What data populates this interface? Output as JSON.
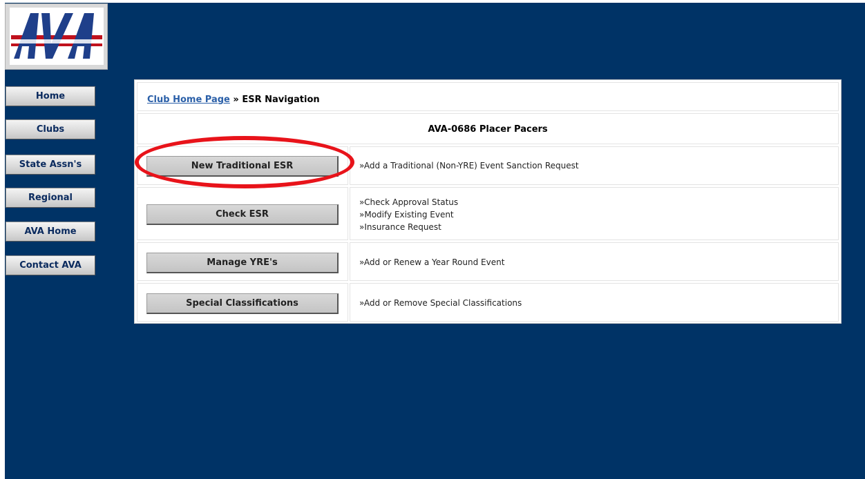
{
  "logo": {
    "text": "AVA",
    "colors": {
      "blue": "#1f3f8a",
      "red": "#c0121d"
    }
  },
  "sidebar": {
    "items": [
      {
        "label": "Home"
      },
      {
        "label": "Clubs"
      },
      {
        "label": "State Assn's"
      },
      {
        "label": "Regional"
      },
      {
        "label": "AVA Home"
      },
      {
        "label": "Contact AVA"
      }
    ]
  },
  "breadcrumb": {
    "link": "Club Home Page",
    "separator": "»",
    "current": "ESR Navigation"
  },
  "club": {
    "name": "AVA-0686 Placer Pacers"
  },
  "actions": [
    {
      "button": "New Traditional ESR",
      "lines": [
        "»Add a Traditional (Non-YRE) Event Sanction Request"
      ]
    },
    {
      "button": "Check ESR",
      "lines": [
        "»Check Approval Status",
        "»Modify Existing Event",
        "»Insurance Request"
      ]
    },
    {
      "button": "Manage YRE's",
      "lines": [
        "»Add or Renew a Year Round Event"
      ]
    },
    {
      "button": "Special Classifications",
      "lines": [
        "»Add or Remove Special Classifications"
      ]
    }
  ],
  "annotation": {
    "highlight_color": "#e8131a"
  },
  "theme": {
    "background": "#003366",
    "link": "#2a5fa8"
  }
}
